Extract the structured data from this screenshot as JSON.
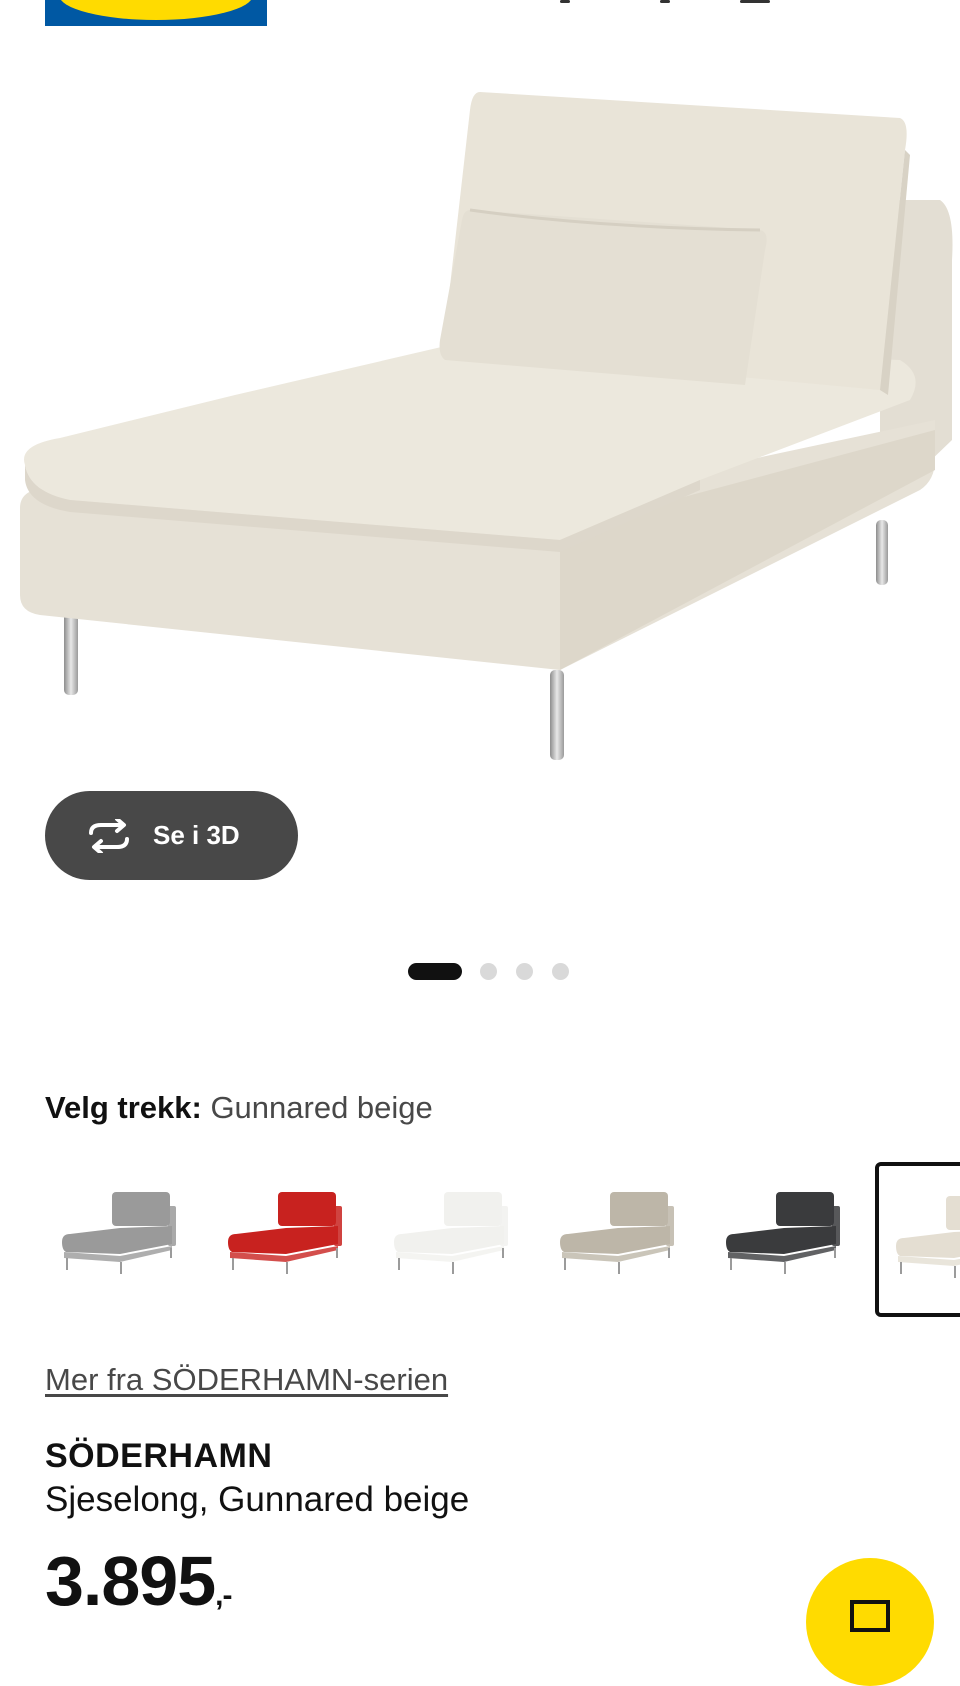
{
  "header": {
    "logo_text": "IKEA"
  },
  "gallery": {
    "see_3d_label": "Se i 3D",
    "active_index": 0,
    "count": 4
  },
  "cover": {
    "label": "Velg trekk:",
    "selected_value": "Gunnared beige",
    "options": [
      {
        "color": "#9a9a9a"
      },
      {
        "color": "#c8221f"
      },
      {
        "color": "#f1f1ee"
      },
      {
        "color": "#bdb6a8"
      },
      {
        "color": "#3a3b3d"
      },
      {
        "color": "#e4ded2"
      }
    ],
    "selected_option": 5
  },
  "series_link": "Mer fra SÖDERHAMN-serien",
  "product": {
    "name": "SÖDERHAMN",
    "description": "Sjeselong, Gunnared beige",
    "price_main": "3.895",
    "price_suffix": ",-"
  },
  "colors": {
    "brand_blue": "#0058a3",
    "brand_yellow": "#ffdb00"
  }
}
